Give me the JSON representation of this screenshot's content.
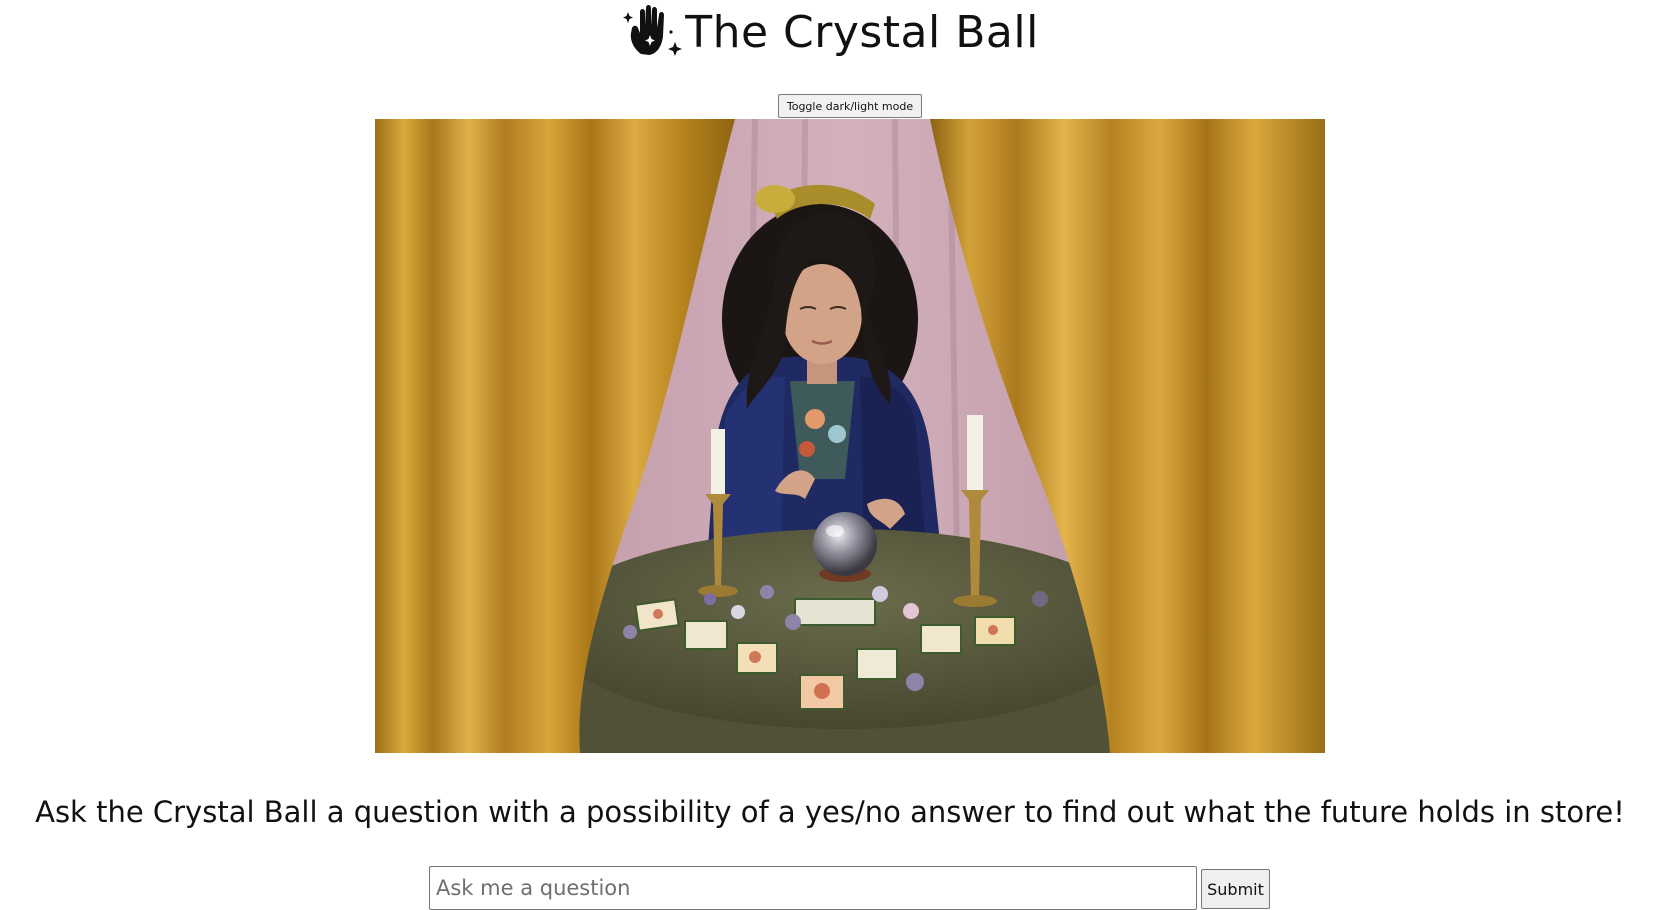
{
  "header": {
    "icon": "hand-sparkles-icon",
    "title": "The Crystal Ball"
  },
  "toggle_button": {
    "label": "Toggle dark/light mode"
  },
  "hero_image": {
    "subject": "fortune teller at a table with crystal ball, candles and tarot cards framed by gold curtains"
  },
  "instruction_text": "Ask the Crystal Ball a question with a possibility of a yes/no answer to find out what the future holds in store!",
  "question_form": {
    "input_placeholder": "Ask me a question",
    "input_value": "",
    "submit_label": "Submit"
  },
  "colors": {
    "background": "#ffffff",
    "text": "#111111",
    "curtain_gold": "#c99a2a",
    "backdrop_pink": "#c7a4b0",
    "robe_navy": "#1e2a66",
    "tablecloth_olive": "#5b5c3f"
  }
}
